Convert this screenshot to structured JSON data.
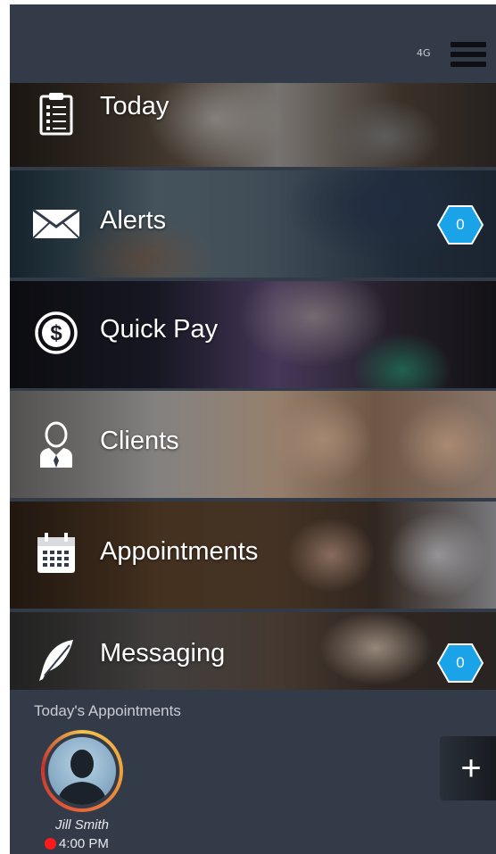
{
  "status_bar": {
    "signal": "4G"
  },
  "menu": {
    "items": [
      {
        "label": "Today",
        "icon": "clipboard-icon"
      },
      {
        "label": "Alerts",
        "icon": "envelope-icon",
        "badge": "0"
      },
      {
        "label": "Quick Pay",
        "icon": "dollar-icon"
      },
      {
        "label": "Clients",
        "icon": "person-icon"
      },
      {
        "label": "Appointments",
        "icon": "calendar-icon"
      },
      {
        "label": "Messaging",
        "icon": "feather-icon",
        "badge": "0"
      }
    ]
  },
  "appointments": {
    "title": "Today's Appointments",
    "items": [
      {
        "name": "Jill Smith",
        "time": "4:00 PM",
        "status_color": "#ff1a1a"
      }
    ],
    "add_label": "+"
  },
  "colors": {
    "background": "#343b48",
    "badge": "#1aa3e8",
    "status_dot": "#ff1a1a"
  }
}
